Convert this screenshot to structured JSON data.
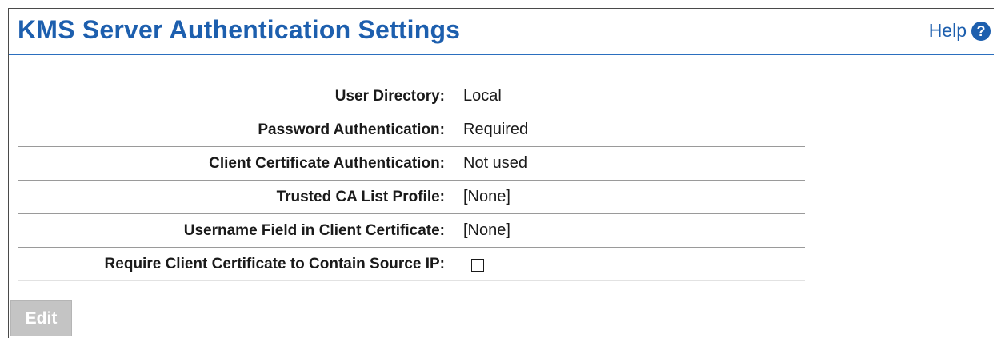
{
  "header": {
    "title": "KMS Server Authentication Settings",
    "help_label": "Help",
    "help_icon": "question-circle-icon",
    "help_icon_glyph": "?"
  },
  "settings": [
    {
      "label": "User Directory:",
      "value": "Local"
    },
    {
      "label": "Password Authentication:",
      "value": "Required"
    },
    {
      "label": "Client Certificate Authentication:",
      "value": "Not used"
    },
    {
      "label": "Trusted CA List Profile:",
      "value": "[None]"
    },
    {
      "label": "Username Field in Client Certificate:",
      "value": "[None]"
    },
    {
      "label": "Require Client Certificate to Contain Source IP:",
      "checked": false
    }
  ],
  "actions": {
    "edit_label": "Edit",
    "edit_enabled": false
  },
  "colors": {
    "title": "#1d5fae",
    "header_rule": "#2b6fbf",
    "disabled_button": "#c4c4c4"
  }
}
